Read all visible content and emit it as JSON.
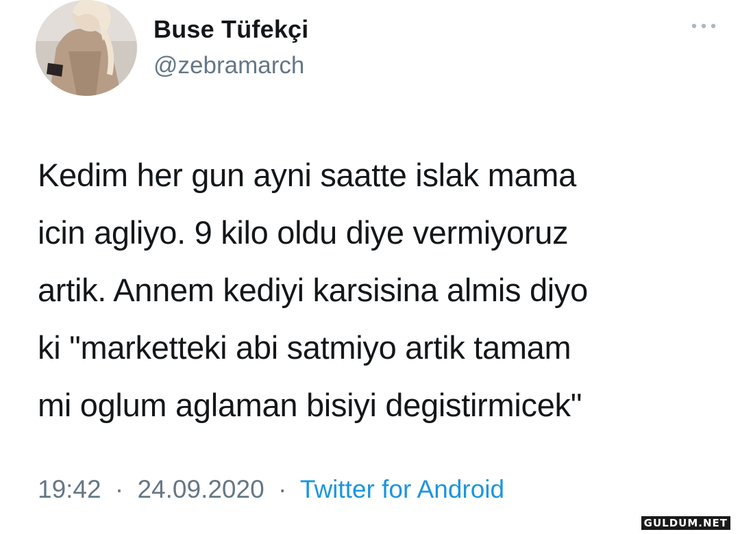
{
  "tweet": {
    "author": {
      "display_name": "Buse Tüfekçi",
      "handle": "@zebramarch"
    },
    "more_icon": "more-horizontal-icon",
    "text_lines": [
      "Kedim her gun ayni saatte islak mama",
      "icin agliyo. 9 kilo oldu diye vermiyoruz",
      "artik. Annem kediyi karsisina almis diyo",
      "ki \"marketteki abi satmiyo artik tamam",
      "mi oglum aglaman bisiyi degistirmicek\""
    ],
    "time": "19:42",
    "separator": "·",
    "date": "24.09.2020",
    "source": "Twitter for Android"
  },
  "watermark": "GULDUM.NET",
  "colors": {
    "text": "#14171a",
    "secondary": "#657786",
    "link": "#1b95e0",
    "background": "#ffffff"
  }
}
